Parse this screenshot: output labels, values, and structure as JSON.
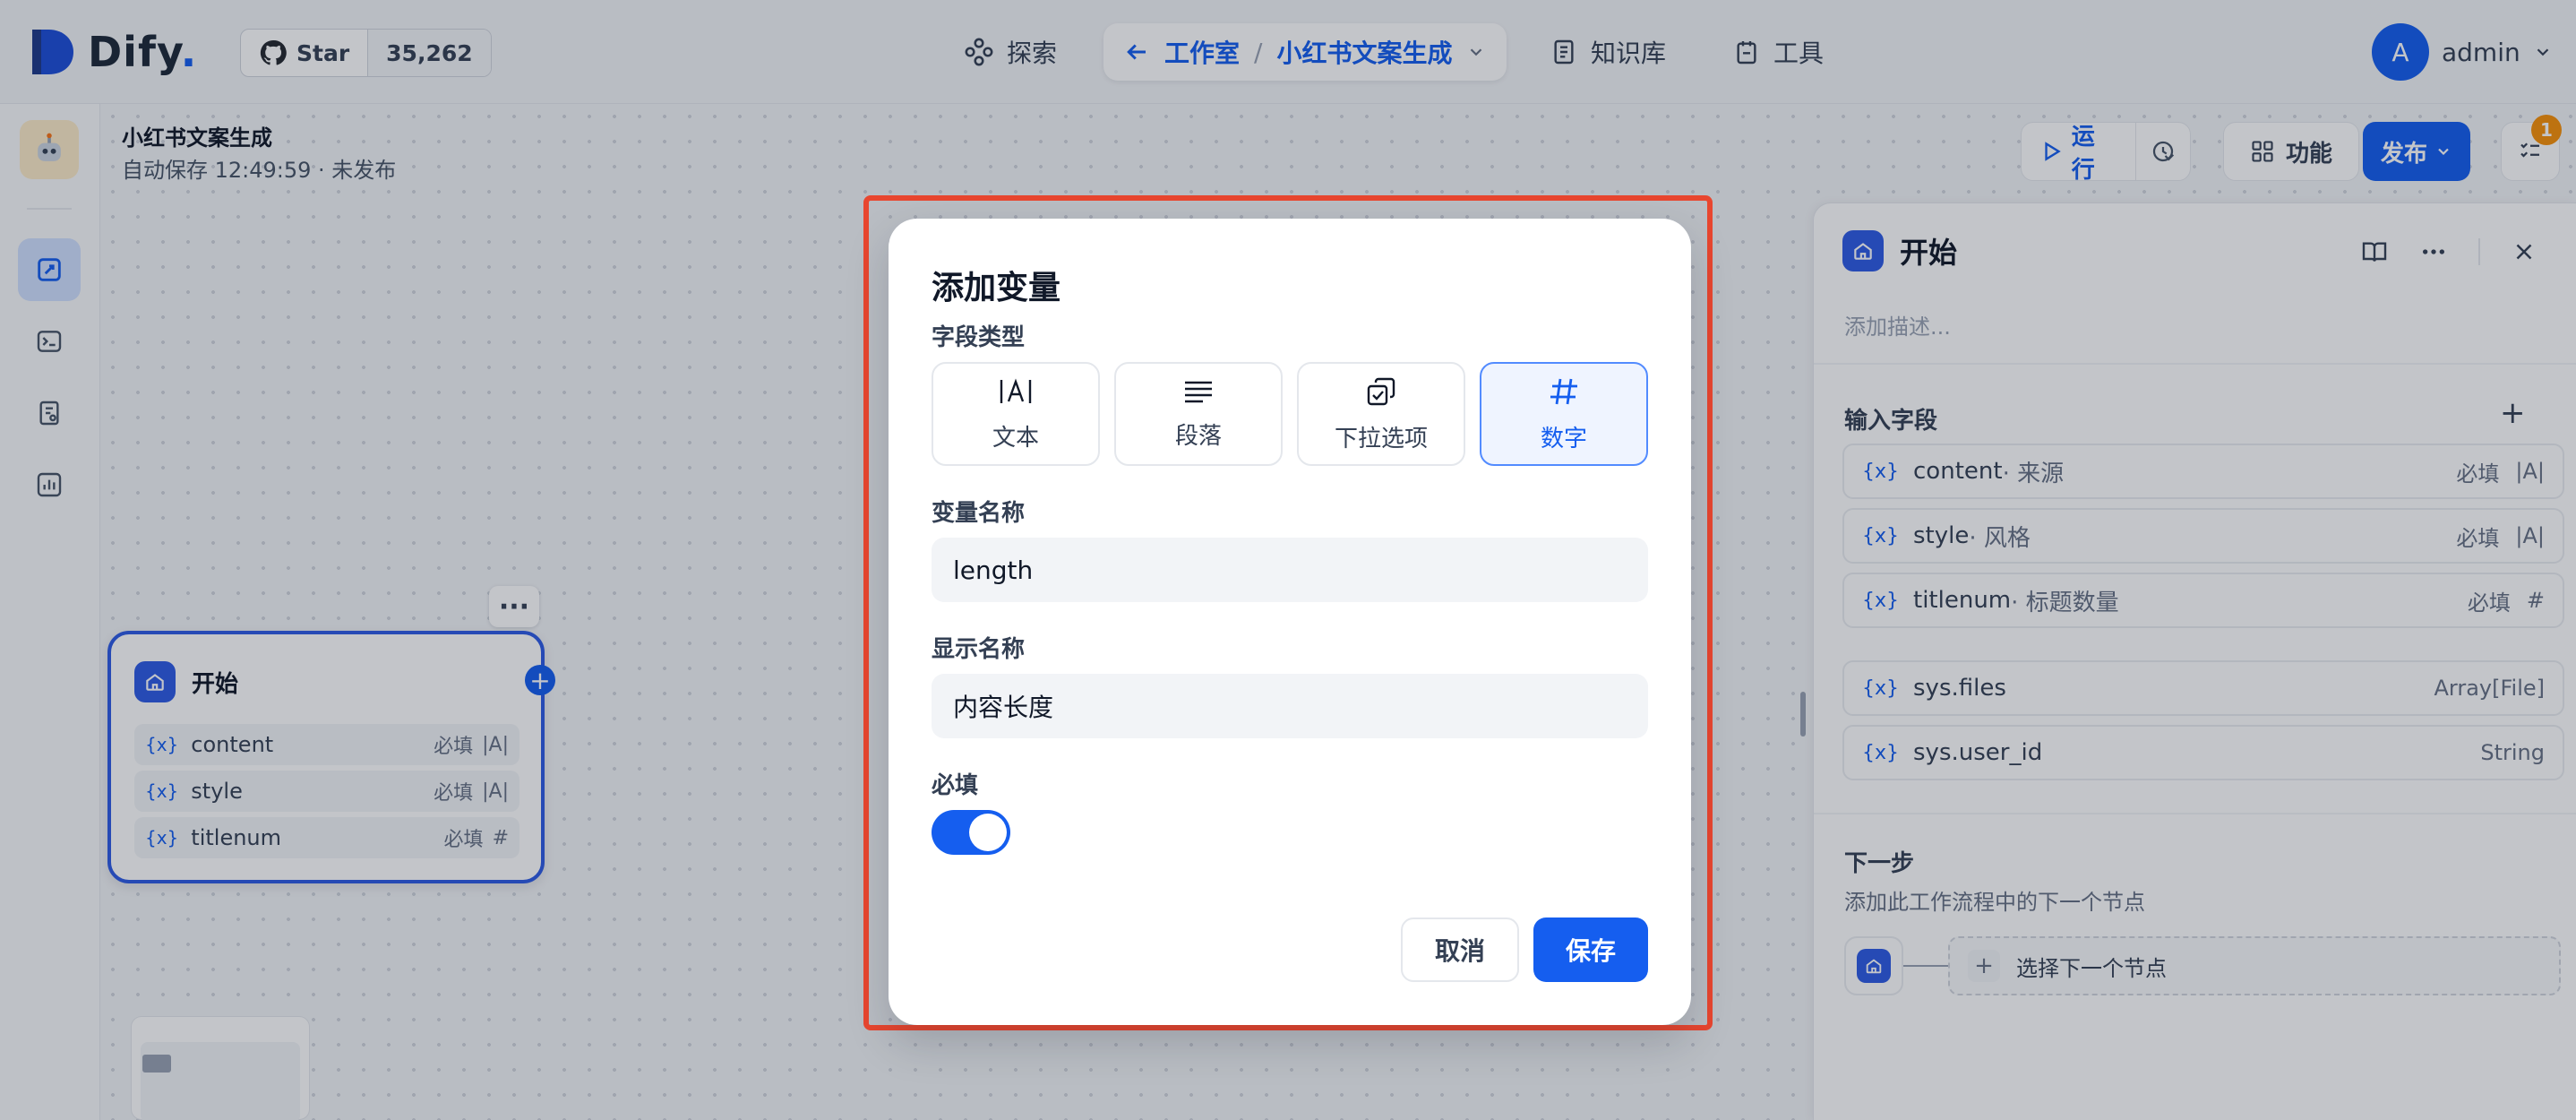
{
  "brand": {
    "name": "Dify",
    "dot": "."
  },
  "github": {
    "star_label": "Star",
    "count": "35,262"
  },
  "nav": {
    "explore": "探索",
    "studio": "工作室",
    "separator": "/",
    "current_app": "小红书文案生成",
    "knowledge": "知识库",
    "tools": "工具"
  },
  "user": {
    "initial": "A",
    "name": "admin"
  },
  "app": {
    "title": "小红书文案生成",
    "status": "自动保存 12:49:59 · 未发布"
  },
  "toolbar": {
    "run": "运行",
    "features": "功能",
    "publish": "发布",
    "checklist_badge": "1"
  },
  "start_node": {
    "title": "开始",
    "vars": [
      {
        "name": "content",
        "required": "必填",
        "type_glyph": "|A|"
      },
      {
        "name": "style",
        "required": "必填",
        "type_glyph": "|A|"
      },
      {
        "name": "titlenum",
        "required": "必填",
        "type_glyph": "#"
      }
    ]
  },
  "panel": {
    "title": "开始",
    "description_placeholder": "添加描述...",
    "input_section": "输入字段",
    "inputs": [
      {
        "name": "content",
        "label": " · 来源",
        "required": "必填",
        "type_glyph": "|A|"
      },
      {
        "name": "style",
        "label": " · 风格",
        "required": "必填",
        "type_glyph": "|A|"
      },
      {
        "name": "titlenum",
        "label": " · 标题数量",
        "required": "必填",
        "type_glyph": "#"
      }
    ],
    "system_vars": [
      {
        "name": "sys.files",
        "type": "Array[File]"
      },
      {
        "name": "sys.user_id",
        "type": "String"
      }
    ],
    "next_section": "下一步",
    "next_desc": "添加此工作流程中的下一个节点",
    "next_button": "选择下一个节点"
  },
  "modal": {
    "title": "添加变量",
    "field_type_label": "字段类型",
    "types": [
      {
        "label": "文本",
        "selected": false
      },
      {
        "label": "段落",
        "selected": false
      },
      {
        "label": "下拉选项",
        "selected": false
      },
      {
        "label": "数字",
        "selected": true
      }
    ],
    "var_name_label": "变量名称",
    "var_name_value": "length",
    "display_name_label": "显示名称",
    "display_name_value": "内容长度",
    "required_label": "必填",
    "required_on": true,
    "cancel": "取消",
    "save": "保存"
  },
  "colors": {
    "accent": "#155eef",
    "highlight_frame": "#e8462f",
    "badge": "#f79009"
  }
}
